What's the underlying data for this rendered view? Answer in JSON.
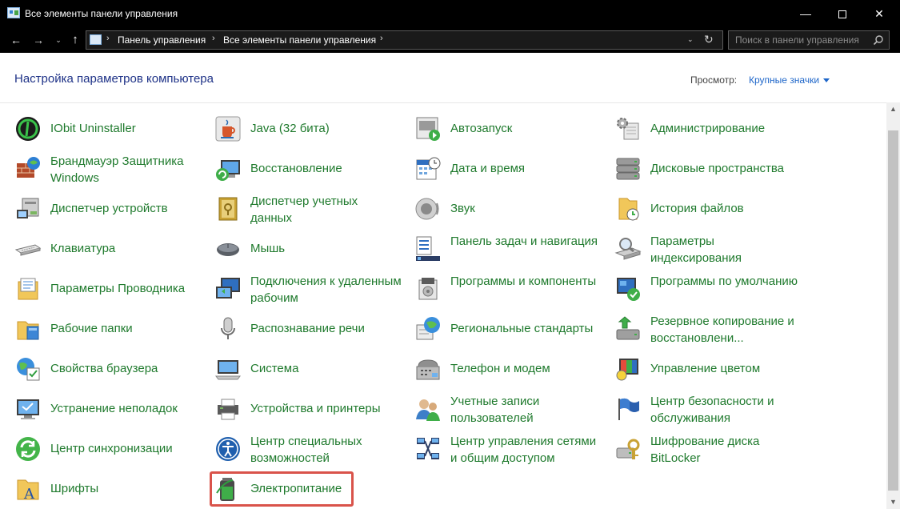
{
  "window": {
    "title": "Все элементы панели управления",
    "minimize_glyph": "—",
    "close_glyph": "✕"
  },
  "nav": {
    "back_glyph": "←",
    "forward_glyph": "→",
    "recent_glyph": "⌄",
    "up_glyph": "↑",
    "breadcrumbs": [
      "Панель управления",
      "Все элементы панели управления"
    ],
    "crumb_separator": "›",
    "dropdown_glyph": "⌄",
    "refresh_glyph": "↻",
    "search_placeholder": "Поиск в панели управления"
  },
  "header": {
    "title": "Настройка параметров компьютера",
    "view_label": "Просмотр:",
    "view_value": "Крупные значки"
  },
  "scrollbar": {
    "up_glyph": "▲",
    "down_glyph": "▼"
  },
  "columns": [
    [
      {
        "label": "IObit Uninstaller",
        "icon": "iobit-icon"
      },
      {
        "label": "Брандмауэр Защитника Windows",
        "icon": "firewall-icon"
      },
      {
        "label": "Диспетчер устройств",
        "icon": "device-manager-icon"
      },
      {
        "label": "Клавиатура",
        "icon": "keyboard-icon"
      },
      {
        "label": "Параметры Проводника",
        "icon": "explorer-options-icon"
      },
      {
        "label": "Рабочие папки",
        "icon": "work-folders-icon"
      },
      {
        "label": "Свойства браузера",
        "icon": "browser-properties-icon"
      },
      {
        "label": "Устранение неполадок",
        "icon": "troubleshooting-icon"
      },
      {
        "label": "Центр синхронизации",
        "icon": "sync-center-icon"
      },
      {
        "label": "Шрифты",
        "icon": "fonts-icon"
      }
    ],
    [
      {
        "label": "Java (32 бита)",
        "icon": "java-icon"
      },
      {
        "label": "Восстановление",
        "icon": "recovery-icon"
      },
      {
        "label": "Диспетчер учетных данных",
        "icon": "credential-manager-icon"
      },
      {
        "label": "Мышь",
        "icon": "mouse-icon"
      },
      {
        "label": "Подключения к удаленным рабочим",
        "icon": "remote-desktop-icon"
      },
      {
        "label": "Распознавание речи",
        "icon": "speech-recognition-icon"
      },
      {
        "label": "Система",
        "icon": "system-icon"
      },
      {
        "label": "Устройства и принтеры",
        "icon": "printers-icon"
      },
      {
        "label": "Центр специальных возможностей",
        "icon": "ease-of-access-icon"
      },
      {
        "label": "Электропитание",
        "icon": "power-options-icon"
      }
    ],
    [
      {
        "label": "Автозапуск",
        "icon": "autoplay-icon"
      },
      {
        "label": "Дата и время",
        "icon": "date-time-icon"
      },
      {
        "label": "Звук",
        "icon": "sound-icon"
      },
      {
        "label": "Панель задач и навигация",
        "icon": "taskbar-icon"
      },
      {
        "label": "Программы и компоненты",
        "icon": "programs-features-icon"
      },
      {
        "label": "Региональные стандарты",
        "icon": "region-icon"
      },
      {
        "label": "Телефон и модем",
        "icon": "phone-modem-icon"
      },
      {
        "label": "Учетные записи пользователей",
        "icon": "user-accounts-icon"
      },
      {
        "label": "Центр управления сетями и общим доступом",
        "icon": "network-center-icon"
      }
    ],
    [
      {
        "label": "Администрирование",
        "icon": "admin-tools-icon"
      },
      {
        "label": "Дисковые пространства",
        "icon": "storage-spaces-icon"
      },
      {
        "label": "История файлов",
        "icon": "file-history-icon"
      },
      {
        "label": "Параметры индексирования",
        "icon": "indexing-icon"
      },
      {
        "label": "Программы по умолчанию",
        "icon": "default-programs-icon"
      },
      {
        "label": "Резервное копирование и восстановлени...",
        "icon": "backup-icon"
      },
      {
        "label": "Управление цветом",
        "icon": "color-management-icon"
      },
      {
        "label": "Центр безопасности и обслуживания",
        "icon": "security-center-icon"
      },
      {
        "label": "Шифрование диска BitLocker",
        "icon": "bitlocker-icon"
      }
    ]
  ],
  "colors": {
    "link_green": "#1f7a2d",
    "title_blue": "#1e3287",
    "highlight_red": "#d9534a"
  }
}
